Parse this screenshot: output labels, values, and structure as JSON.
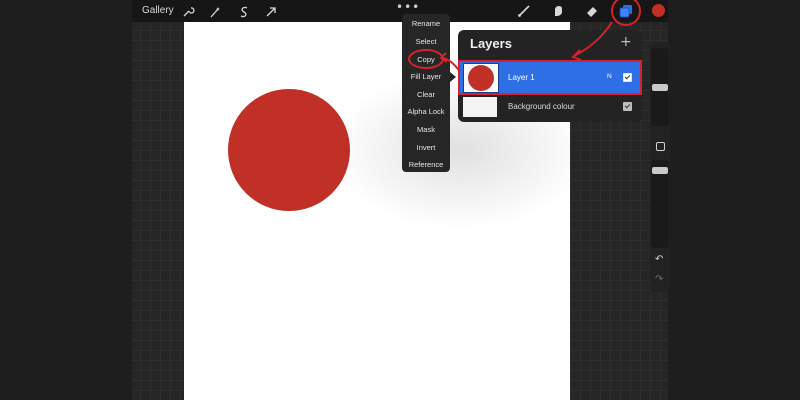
{
  "toolbar": {
    "gallery_label": "Gallery",
    "more_label": "•••",
    "left_icons": [
      "wrench-icon",
      "magic-wand-icon",
      "selection-icon",
      "transform-arrow-icon"
    ],
    "right_icons": [
      "brush-icon",
      "smudge-icon",
      "eraser-icon",
      "layers-icon"
    ],
    "active_color": "#c03027"
  },
  "layer_menu": {
    "items": [
      "Rename",
      "Select",
      "Copy",
      "Fill Layer",
      "Clear",
      "Alpha Lock",
      "Mask",
      "Invert",
      "Reference"
    ],
    "highlighted": "Copy"
  },
  "layers_panel": {
    "title": "Layers",
    "add_label": "+",
    "layers": [
      {
        "name": "Layer 1",
        "blend_mode": "N",
        "visible": true,
        "selected": true
      },
      {
        "name": "Background colour",
        "visible": true,
        "selected": false
      }
    ]
  },
  "sidebar": {
    "undo_label": "↶",
    "redo_label": "↷"
  },
  "canvas": {
    "background": "#ffffff",
    "shape_color": "#c03027"
  },
  "colors": {
    "accent": "#2f6fe6",
    "annotation": "#d3242b"
  }
}
